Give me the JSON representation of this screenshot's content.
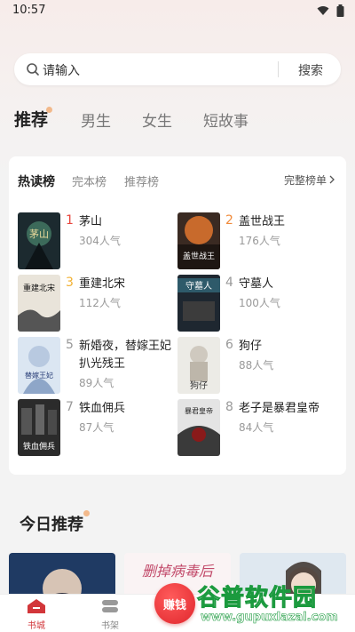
{
  "status_bar": {
    "time": "10:57"
  },
  "search": {
    "placeholder": "请输入",
    "button_label": "搜索"
  },
  "channel_tabs": [
    {
      "label": "推荐",
      "active": true
    },
    {
      "label": "男生",
      "active": false
    },
    {
      "label": "女生",
      "active": false
    },
    {
      "label": "短故事",
      "active": false
    }
  ],
  "ranking": {
    "tabs": [
      {
        "label": "热读榜",
        "active": true
      },
      {
        "label": "完本榜",
        "active": false
      },
      {
        "label": "推荐榜",
        "active": false
      }
    ],
    "full_list_label": "完整榜单",
    "books": [
      {
        "rank": "1",
        "title": "茅山",
        "popularity": "304人气"
      },
      {
        "rank": "2",
        "title": "盖世战王",
        "popularity": "176人气"
      },
      {
        "rank": "3",
        "title": "重建北宋",
        "popularity": "112人气"
      },
      {
        "rank": "4",
        "title": "守墓人",
        "popularity": "100人气"
      },
      {
        "rank": "5",
        "title": "新婚夜，替嫁王妃扒光残王",
        "popularity": "89人气"
      },
      {
        "rank": "6",
        "title": "狗仔",
        "popularity": "88人气"
      },
      {
        "rank": "7",
        "title": "铁血佣兵",
        "popularity": "87人气"
      },
      {
        "rank": "8",
        "title": "老子是暴君皇帝",
        "popularity": "84人气"
      }
    ],
    "cover_text": [
      "茅山",
      "盖世战王",
      "重建北宋",
      "守墓人",
      "替嫁王妃",
      "狗仔",
      "铁血佣兵",
      "暴君皇帝"
    ]
  },
  "today": {
    "title": "今日推荐",
    "card_text": "删掉病毒后"
  },
  "bottom_nav": {
    "items": [
      {
        "label": "书城",
        "active": true
      },
      {
        "label": "书架",
        "active": false
      }
    ],
    "earn_label": "赚钱"
  },
  "watermark": {
    "text": "谷普软件园",
    "url": "www.gupuxlazal.com"
  },
  "colors": {
    "accent": "#d2363a",
    "rank1": "#e8453c",
    "rank2": "#f08a3a",
    "rank3": "#f2b133",
    "dot": "#f2b98b"
  }
}
